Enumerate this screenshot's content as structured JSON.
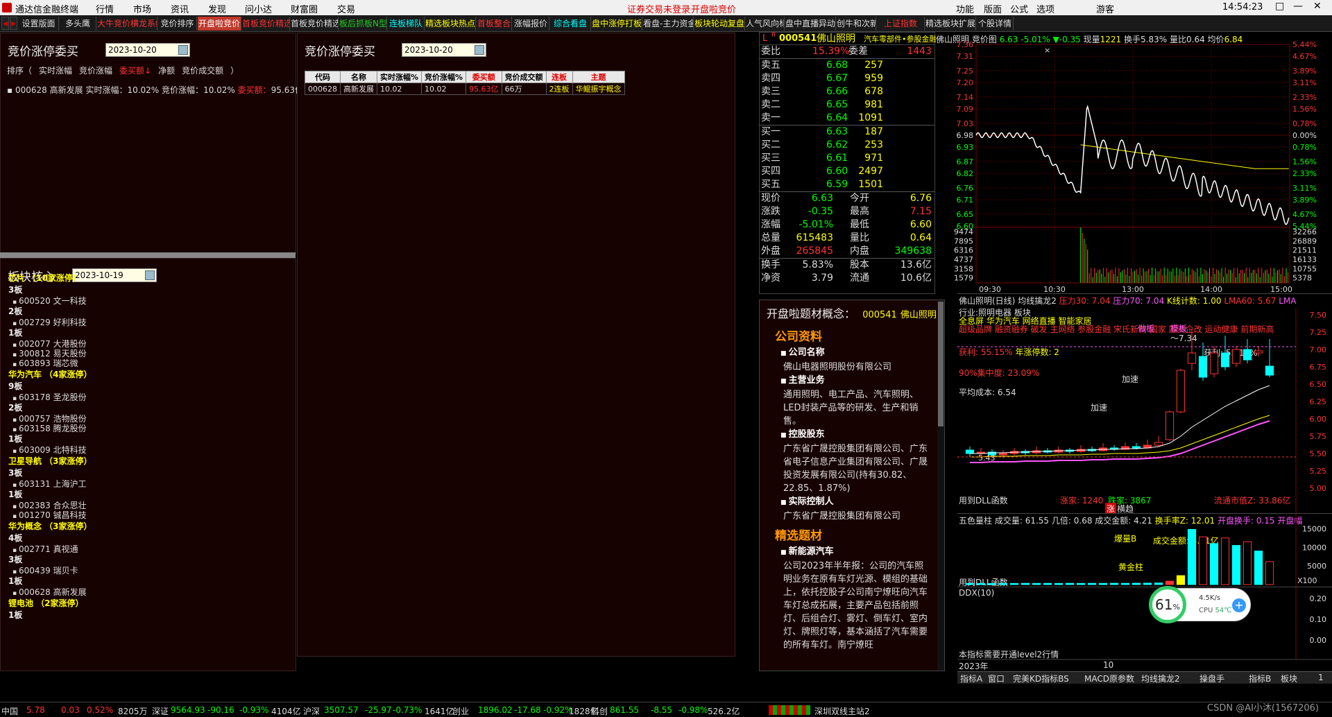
{
  "menubar": {
    "app_title": "通达信金融终端",
    "menus": [
      "行情",
      "市场",
      "资讯",
      "发现",
      "问小达",
      "财富圈",
      "交易"
    ],
    "notices": [
      "证券交易未登录",
      "开盘啦竞价"
    ],
    "right_menus": [
      "功能",
      "版面",
      "公式",
      "选项"
    ],
    "guest": "游客",
    "time": "14:54:23",
    "window_controls": [
      "□",
      "—",
      "✕"
    ]
  },
  "tabs": [
    {
      "label": "设置版面",
      "style": "w"
    },
    {
      "label": "多头鹰",
      "style": "w"
    },
    {
      "label": "大牛竞价横龙系统",
      "style": "r"
    },
    {
      "label": "竞价排序",
      "style": "w"
    },
    {
      "label": "开盘啦竞价",
      "style": "a"
    },
    {
      "label": "首板竞价精选",
      "style": "r"
    },
    {
      "label": "首板竞价精选2",
      "style": "w"
    },
    {
      "label": "板后抓板N型",
      "style": "g"
    },
    {
      "label": "连板梯队",
      "style": "c"
    },
    {
      "label": "精选板块热点",
      "style": "y"
    },
    {
      "label": "首板整合",
      "style": "r"
    },
    {
      "label": "涨幅报价",
      "style": "w"
    },
    {
      "label": "综合看盘",
      "style": "c"
    },
    {
      "label": "盘中涨停打板",
      "style": "y"
    },
    {
      "label": "看盘-主力资金",
      "style": "w"
    },
    {
      "label": "板块轮动复盘",
      "style": "y"
    },
    {
      "label": "人气风向标",
      "style": "w"
    },
    {
      "label": "盘中直播异动",
      "style": "w"
    },
    {
      "label": "创牛和次新",
      "style": "w"
    },
    {
      "label": "上证指数",
      "style": "r"
    },
    {
      "label": "精选板块扩展",
      "style": "w"
    },
    {
      "label": "个股详情",
      "style": "w"
    }
  ],
  "left_panel": {
    "title": "竞价涨停委买",
    "date": "2023-10-20",
    "sort_label": "排序（",
    "sort_options": [
      "实时涨幅",
      "竞价涨幅",
      "委买额↓",
      "净额",
      "竞价成交额"
    ],
    "sort_end": "）",
    "row": {
      "code": "000628",
      "name": "高新发展",
      "rt_label": "实时涨幅：",
      "rt_val": "10.02%",
      "bid_label": "竞价涨幅：",
      "bid_val": "10.02%",
      "buy_label": "委买额：",
      "buy_val": "95.63亿"
    }
  },
  "mid_panel": {
    "title": "竞价涨停委买",
    "date": "2023-10-20",
    "headers": [
      "代码",
      "名称",
      "实时涨幅%",
      "竞价涨幅%",
      "委买额",
      "竞价成交额",
      "连板",
      "主题"
    ],
    "rows": [
      [
        "000628",
        "高新发展",
        "10.02",
        "10.02",
        "95.63亿",
        "66万",
        "2连板",
        "华鲲振宇概念"
      ]
    ]
  },
  "sector_panel": {
    "title": "板块核心",
    "date": "2023-10-19",
    "groups": [
      {
        "name": "芯片 （10家涨停）",
        "boards": [
          {
            "b": "3板",
            "s": [
              "600520 文一科技"
            ]
          },
          {
            "b": "2板",
            "s": [
              "002729 好利科技"
            ]
          },
          {
            "b": "1板",
            "s": [
              "002077 大港股份",
              "300812 易天股份",
              "603893 瑞芯微"
            ]
          }
        ]
      },
      {
        "name": "华为汽车 （4家涨停）",
        "boards": [
          {
            "b": "9板",
            "s": [
              "603178 圣龙股份"
            ]
          },
          {
            "b": "2板",
            "s": [
              "000757 浩物股份",
              "603158 腾龙股份"
            ]
          },
          {
            "b": "1板",
            "s": [
              "603009 北特科技"
            ]
          }
        ]
      },
      {
        "name": "卫星导航 （3家涨停）",
        "boards": [
          {
            "b": "3板",
            "s": [
              "603131 上海沪工"
            ]
          },
          {
            "b": "1板",
            "s": [
              "002383 合众思壮",
              "001270 铖昌科技"
            ]
          }
        ]
      },
      {
        "name": "华为概念 （3家涨停）",
        "boards": [
          {
            "b": "4板",
            "s": [
              "002771 真视通"
            ]
          },
          {
            "b": "3板",
            "s": [
              "600439 瑞贝卡"
            ]
          },
          {
            "b": "1板",
            "s": [
              "000628 高新发展"
            ]
          }
        ]
      },
      {
        "name": "锂电池 （2家涨停）",
        "boards": [
          {
            "b": "1板",
            "s": []
          }
        ]
      }
    ]
  },
  "quote": {
    "flag": "L",
    "flag_r": "R",
    "code": "000541",
    "name": "佛山照明",
    "tag": "汽车零部件•参股金融",
    "weibi_label": "委比",
    "weibi": "15.39%",
    "weicha_label": "委差",
    "weicha": "1443",
    "asks": [
      [
        "卖五",
        "6.68",
        "257"
      ],
      [
        "卖四",
        "6.67",
        "959"
      ],
      [
        "卖三",
        "6.66",
        "678"
      ],
      [
        "卖二",
        "6.65",
        "981"
      ],
      [
        "卖一",
        "6.64",
        "1091"
      ]
    ],
    "bids": [
      [
        "买一",
        "6.63",
        "187"
      ],
      [
        "买二",
        "6.62",
        "253"
      ],
      [
        "买三",
        "6.61",
        "971"
      ],
      [
        "买四",
        "6.60",
        "2497"
      ],
      [
        "买五",
        "6.59",
        "1501"
      ]
    ],
    "stats": [
      [
        "现价",
        "6.63",
        "今开",
        "6.76"
      ],
      [
        "涨跌",
        "-0.35",
        "最高",
        "7.15"
      ],
      [
        "涨幅",
        "-5.01%",
        "最低",
        "6.60"
      ],
      [
        "总量",
        "615483",
        "量比",
        "0.64"
      ],
      [
        "外盘",
        "265845",
        "内盘",
        "349638"
      ]
    ],
    "stats2": [
      [
        "换手",
        "5.83%",
        "股本",
        "13.6亿"
      ],
      [
        "净资",
        "3.79",
        "流通",
        "10.6亿"
      ]
    ]
  },
  "concept": {
    "title": "开盘啦题材概念：",
    "code": "000541",
    "name": "佛山照明",
    "sections": [
      {
        "head": "公司资料",
        "items": [
          {
            "k": "公司名称",
            "v": "佛山电器照明股份有限公司"
          },
          {
            "k": "主营业务",
            "v": "通用照明、电工产品、汽车照明、LED封装产品等的研发、生产和销售。"
          },
          {
            "k": "控股股东",
            "v": "广东省广晟控股集团有限公司、广东省电子信息产业集团有限公司、广晟投资发展有限公司(持有30.82、22.85、1.87%)"
          },
          {
            "k": "实际控制人",
            "v": "广东省广晟控股集团有限公司"
          }
        ]
      },
      {
        "head": "精选题材",
        "items": [
          {
            "k": "新能源汽车",
            "v": "公司2023年半年报：公司的汽车照明业务在原有车灯光源、模组的基础上，依托控股子公司南宁燎旺向汽车车灯总成拓展，主要产品包括前照灯、后组合灯、雾灯、倒车灯、室内灯、牌照灯等，基本涵括了汽车需要的所有车灯。南宁燎旺"
          }
        ]
      }
    ]
  },
  "intraday": {
    "title": "佛山照明",
    "sub": "竞价图",
    "price": "6.63",
    "pct": "-5.01%",
    "chg": "▼-0.35",
    "xianliang_label": "现量",
    "xianliang": "1221",
    "huanshou_label": "换手",
    "huanshou": "5.83%",
    "liangbi_label": "量比",
    "liangbi": "0.64",
    "junjia_label": "均价",
    "junjia": "6.84",
    "prev_close": "6.98",
    "y_left": [
      "7.36",
      "7.31",
      "7.25",
      "7.20",
      "7.14",
      "7.09",
      "7.03",
      "6.98",
      "6.93",
      "6.87",
      "6.82",
      "6.76",
      "6.71",
      "6.65",
      "6.60"
    ],
    "y_right": [
      "5.44%",
      "4.67%",
      "3.89%",
      "3.11%",
      "2.33%",
      "1.56%",
      "0.78%",
      "0.00%",
      "0.78%",
      "1.56%",
      "2.33%",
      "3.11%",
      "3.89%",
      "4.67%",
      "5.44%"
    ],
    "vol_left": [
      "9474",
      "7895",
      "6316",
      "4737",
      "3158",
      "1579"
    ],
    "vol_right": [
      "32266",
      "26889",
      "21511",
      "16133",
      "10755",
      "5378"
    ],
    "x_labels": [
      "09:30",
      "10:30",
      "13:00",
      "14:00",
      "15:00"
    ]
  },
  "kline": {
    "header": "佛山照明(日线)",
    "header2": "均线擒龙2",
    "pressure1": "压力30: 7.04",
    "pressure2": "压力70: 7.04",
    "kcount": "K线计数: 1.00",
    "lma": "LMA60: 5.67",
    "lma2": "LMA",
    "tags1": "行业:照明电器 板块",
    "tags2": "全息屏 华为汽车 网络直播 智能家居",
    "tags3": "超级品牌 融资融券 破发 主网络 参股金融 宋氏新材 国家 国资企改 运动健康 前期新高",
    "profit": "获利: 55.15%",
    "zt": "年涨停数: 2",
    "conc": "90%集中度: 23.09%",
    "avgcost": "平均成本: 6.54",
    "jiasu": "加速",
    "jiaxu2": "加速",
    "zuoban": "做板",
    "mobian": "模板",
    "sep": "～7.34",
    "huoli": "获利: 55.15%",
    "bottom": "用到DLL函数",
    "zhangjia": "涨家: 1240",
    "diejia": "跌家: 3867",
    "liutong": "流通市值Z: 33.86亿",
    "zhang": "涨",
    "mozhu": "横趋",
    "y": [
      "7.50",
      "7.25",
      "7.00",
      "6.75",
      "6.50",
      "6.25",
      "6.00",
      "5.75",
      "5.50",
      "5.25",
      "5.00"
    ],
    "low_label": "5.43",
    "candles": [
      {
        "o": 5.55,
        "c": 5.5,
        "h": 5.6,
        "l": 5.45
      },
      {
        "o": 5.5,
        "c": 5.52,
        "h": 5.58,
        "l": 5.46
      },
      {
        "o": 5.52,
        "c": 5.48,
        "h": 5.56,
        "l": 5.44
      },
      {
        "o": 5.48,
        "c": 5.5,
        "h": 5.55,
        "l": 5.43
      },
      {
        "o": 5.5,
        "c": 5.53,
        "h": 5.58,
        "l": 5.47
      },
      {
        "o": 5.53,
        "c": 5.51,
        "h": 5.56,
        "l": 5.48
      },
      {
        "o": 5.51,
        "c": 5.54,
        "h": 5.6,
        "l": 5.49
      },
      {
        "o": 5.54,
        "c": 5.52,
        "h": 5.58,
        "l": 5.5
      },
      {
        "o": 5.52,
        "c": 5.55,
        "h": 5.6,
        "l": 5.5
      },
      {
        "o": 5.55,
        "c": 5.53,
        "h": 5.58,
        "l": 5.5
      },
      {
        "o": 5.53,
        "c": 5.56,
        "h": 5.62,
        "l": 5.51
      },
      {
        "o": 5.56,
        "c": 5.54,
        "h": 5.6,
        "l": 5.52
      },
      {
        "o": 5.54,
        "c": 5.58,
        "h": 5.65,
        "l": 5.53
      },
      {
        "o": 5.58,
        "c": 5.56,
        "h": 5.62,
        "l": 5.54
      },
      {
        "o": 5.56,
        "c": 5.6,
        "h": 5.66,
        "l": 5.55
      },
      {
        "o": 5.6,
        "c": 5.58,
        "h": 5.65,
        "l": 5.56
      },
      {
        "o": 5.58,
        "c": 5.62,
        "h": 5.7,
        "l": 5.57
      },
      {
        "o": 5.62,
        "c": 5.66,
        "h": 5.75,
        "l": 5.6
      },
      {
        "o": 5.7,
        "c": 6.1,
        "h": 6.12,
        "l": 5.68
      },
      {
        "o": 6.1,
        "c": 6.7,
        "h": 6.72,
        "l": 6.08
      },
      {
        "o": 6.8,
        "c": 6.95,
        "h": 7.3,
        "l": 6.7
      },
      {
        "o": 6.9,
        "c": 6.6,
        "h": 7.1,
        "l": 6.55
      },
      {
        "o": 6.65,
        "c": 6.95,
        "h": 7.05,
        "l": 6.6
      },
      {
        "o": 6.95,
        "c": 6.75,
        "h": 7.2,
        "l": 6.7
      },
      {
        "o": 6.8,
        "c": 7.0,
        "h": 7.05,
        "l": 6.75
      },
      {
        "o": 7.0,
        "c": 6.85,
        "h": 7.15,
        "l": 6.8
      },
      {
        "o": 6.95,
        "c": 6.98,
        "h": 7.05,
        "l": 6.9
      },
      {
        "o": 6.76,
        "c": 6.63,
        "h": 7.15,
        "l": 6.6
      }
    ],
    "ma": [
      5.5,
      5.5,
      5.51,
      5.51,
      5.52,
      5.52,
      5.53,
      5.53,
      5.54,
      5.54,
      5.55,
      5.55,
      5.56,
      5.56,
      5.57,
      5.57,
      5.58,
      5.6,
      5.65,
      5.75,
      5.88,
      5.98,
      6.08,
      6.18,
      6.26,
      6.34,
      6.42,
      6.48
    ],
    "ma2": [
      5.45,
      5.45,
      5.46,
      5.46,
      5.46,
      5.47,
      5.47,
      5.47,
      5.48,
      5.48,
      5.48,
      5.49,
      5.49,
      5.5,
      5.5,
      5.5,
      5.51,
      5.52,
      5.54,
      5.58,
      5.64,
      5.7,
      5.76,
      5.82,
      5.88,
      5.94,
      6.0,
      6.05
    ]
  },
  "vol_panel": {
    "title": "五色量柱",
    "cjl": "成交量: 61.55",
    "jibei": "几倍: 0.68",
    "cjje": "成交金额: 4.21",
    "hsl": "换手率Z: 12.01",
    "kpshs": "开盘换手: 0.15",
    "kpd": "开盘幅",
    "label1": "爆量B",
    "label2": "成交金额: 4.21亿",
    "label3": "黄金柱",
    "bottom": "用到DLL函数",
    "y": [
      "15000",
      "10000",
      "5000"
    ],
    "x100": "X100",
    "bars": [
      300,
      320,
      290,
      310,
      300,
      330,
      310,
      320,
      300,
      340,
      310,
      330,
      320,
      350,
      330,
      360,
      380,
      420,
      900,
      2400,
      14800,
      12800,
      11000,
      12500,
      10500,
      11500,
      9000,
      6155
    ]
  },
  "ddx_panel": {
    "title": "DDX(10)",
    "note": "本指标需要开通level2行情",
    "y": [
      "0.20",
      "0.10",
      "0.00"
    ],
    "year": "2023年",
    "month": "10"
  },
  "right_axis_top": "1.545",
  "bottom_tabs": [
    "指标A",
    "窗口",
    "完美KD指标BS",
    "MACD原参数",
    "均线擒龙2",
    "操盘手",
    "指标B",
    "板块",
    "1"
  ],
  "cpu": {
    "pct": "61",
    "pct_sign": "%",
    "speed": "4.5K/s",
    "label": "CPU",
    "temp": "54℃",
    "plus": "+"
  },
  "watermark": "CSDN @AI小沐(1567206)",
  "status": [
    {
      "t": "中国",
      "c": "w"
    },
    {
      "t": "5.78",
      "c": "r"
    },
    {
      "t": "0.03",
      "c": "r"
    },
    {
      "t": "0.52%",
      "c": "r"
    },
    {
      "t": "8205万",
      "c": "w"
    },
    {
      "t": "深证",
      "c": "w"
    },
    {
      "t": "9564.93",
      "c": "g"
    },
    {
      "t": "-90.16",
      "c": "g"
    },
    {
      "t": "-0.93%",
      "c": "g"
    },
    {
      "t": "4104亿",
      "c": "w"
    },
    {
      "t": "沪深",
      "c": "w"
    },
    {
      "t": "3507.57",
      "c": "g"
    },
    {
      "t": "-25.97",
      "c": "g"
    },
    {
      "t": "-0.73%",
      "c": "g"
    },
    {
      "t": "1641亿",
      "c": "w"
    },
    {
      "t": "创业",
      "c": "w"
    },
    {
      "t": "1896.02",
      "c": "g"
    },
    {
      "t": "-17.68",
      "c": "g"
    },
    {
      "t": "-0.92%",
      "c": "g"
    },
    {
      "t": "1828亿",
      "c": "w"
    },
    {
      "t": "科创",
      "c": "w"
    },
    {
      "t": "861.55",
      "c": "g"
    },
    {
      "t": "-8.55",
      "c": "g"
    },
    {
      "t": "-0.98%",
      "c": "g"
    },
    {
      "t": "526.2亿",
      "c": "w"
    },
    {
      "t": "深圳双线主站2",
      "c": "w"
    }
  ],
  "colors": {
    "up": "#ff3333",
    "down": "#00ff00",
    "yellow": "#ffff00",
    "cyan": "#00ffff",
    "magenta": "#ff55ff"
  }
}
